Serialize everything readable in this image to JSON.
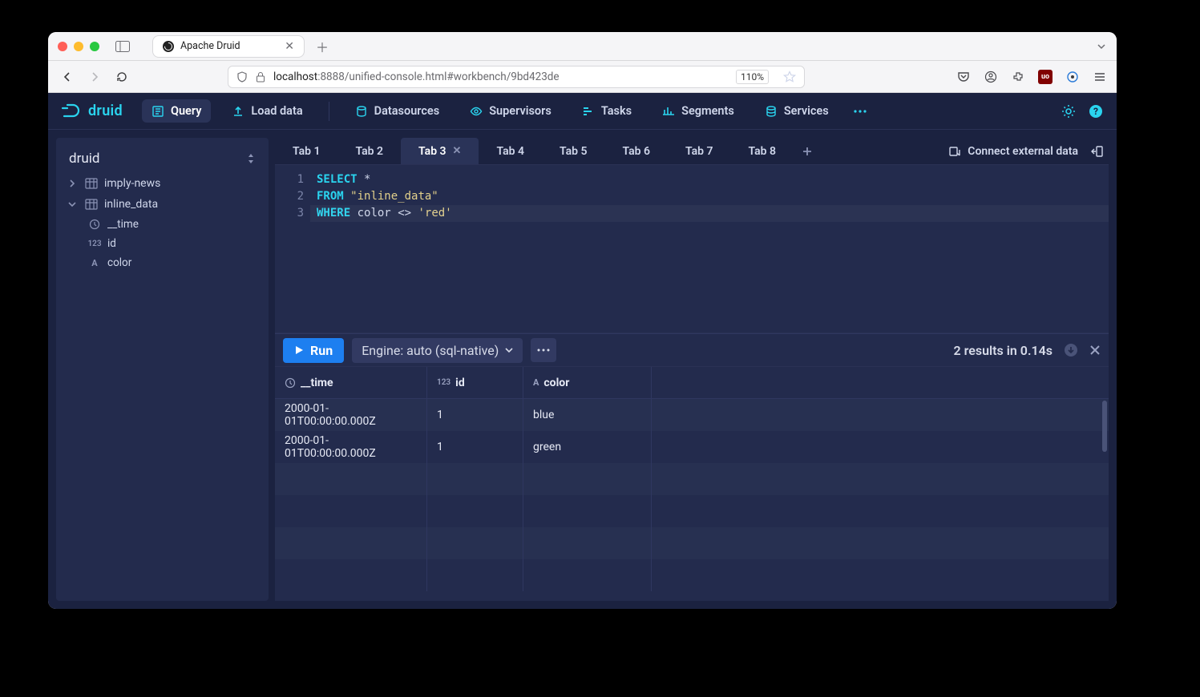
{
  "browser": {
    "tab_title": "Apache Druid",
    "zoom": "110%",
    "url_host": "localhost",
    "url_port_path": ":8888/unified-console.html#workbench/9bd423de"
  },
  "app": {
    "brand": "druid",
    "nav": {
      "query": "Query",
      "load_data": "Load data",
      "datasources": "Datasources",
      "supervisors": "Supervisors",
      "tasks": "Tasks",
      "segments": "Segments",
      "services": "Services"
    }
  },
  "schema": {
    "title": "druid",
    "datasources": [
      {
        "name": "imply-news",
        "expanded": false
      },
      {
        "name": "inline_data",
        "expanded": true,
        "columns": [
          {
            "name": "__time",
            "type": "time"
          },
          {
            "name": "id",
            "type": "number"
          },
          {
            "name": "color",
            "type": "string"
          }
        ]
      }
    ]
  },
  "tabs": {
    "items": [
      "Tab 1",
      "Tab 2",
      "Tab 3",
      "Tab 4",
      "Tab 5",
      "Tab 6",
      "Tab 7",
      "Tab 8"
    ],
    "active_index": 2,
    "connect_external": "Connect external data"
  },
  "editor": {
    "line_numbers": [
      "1",
      "2",
      "3"
    ],
    "tokens": [
      [
        {
          "t": "kw",
          "v": "SELECT"
        },
        {
          "t": "sp",
          "v": " "
        },
        {
          "t": "ident",
          "v": "*"
        }
      ],
      [
        {
          "t": "kw",
          "v": "FROM"
        },
        {
          "t": "sp",
          "v": " "
        },
        {
          "t": "str",
          "v": "\"inline_data\""
        }
      ],
      [
        {
          "t": "kw",
          "v": "WHERE"
        },
        {
          "t": "sp",
          "v": " "
        },
        {
          "t": "ident",
          "v": "color"
        },
        {
          "t": "sp",
          "v": " "
        },
        {
          "t": "ident",
          "v": "<>"
        },
        {
          "t": "sp",
          "v": " "
        },
        {
          "t": "str",
          "v": "'red'"
        }
      ]
    ]
  },
  "toolbar": {
    "run": "Run",
    "engine": "Engine: auto (sql-native)"
  },
  "results": {
    "status": "2 results in 0.14s",
    "columns": [
      {
        "name": "__time",
        "type": "time"
      },
      {
        "name": "id",
        "type": "number"
      },
      {
        "name": "color",
        "type": "string"
      }
    ],
    "rows": [
      {
        "__time": "2000-01-01T00:00:00.000Z",
        "id": "1",
        "color": "blue"
      },
      {
        "__time": "2000-01-01T00:00:00.000Z",
        "id": "1",
        "color": "green"
      }
    ]
  }
}
